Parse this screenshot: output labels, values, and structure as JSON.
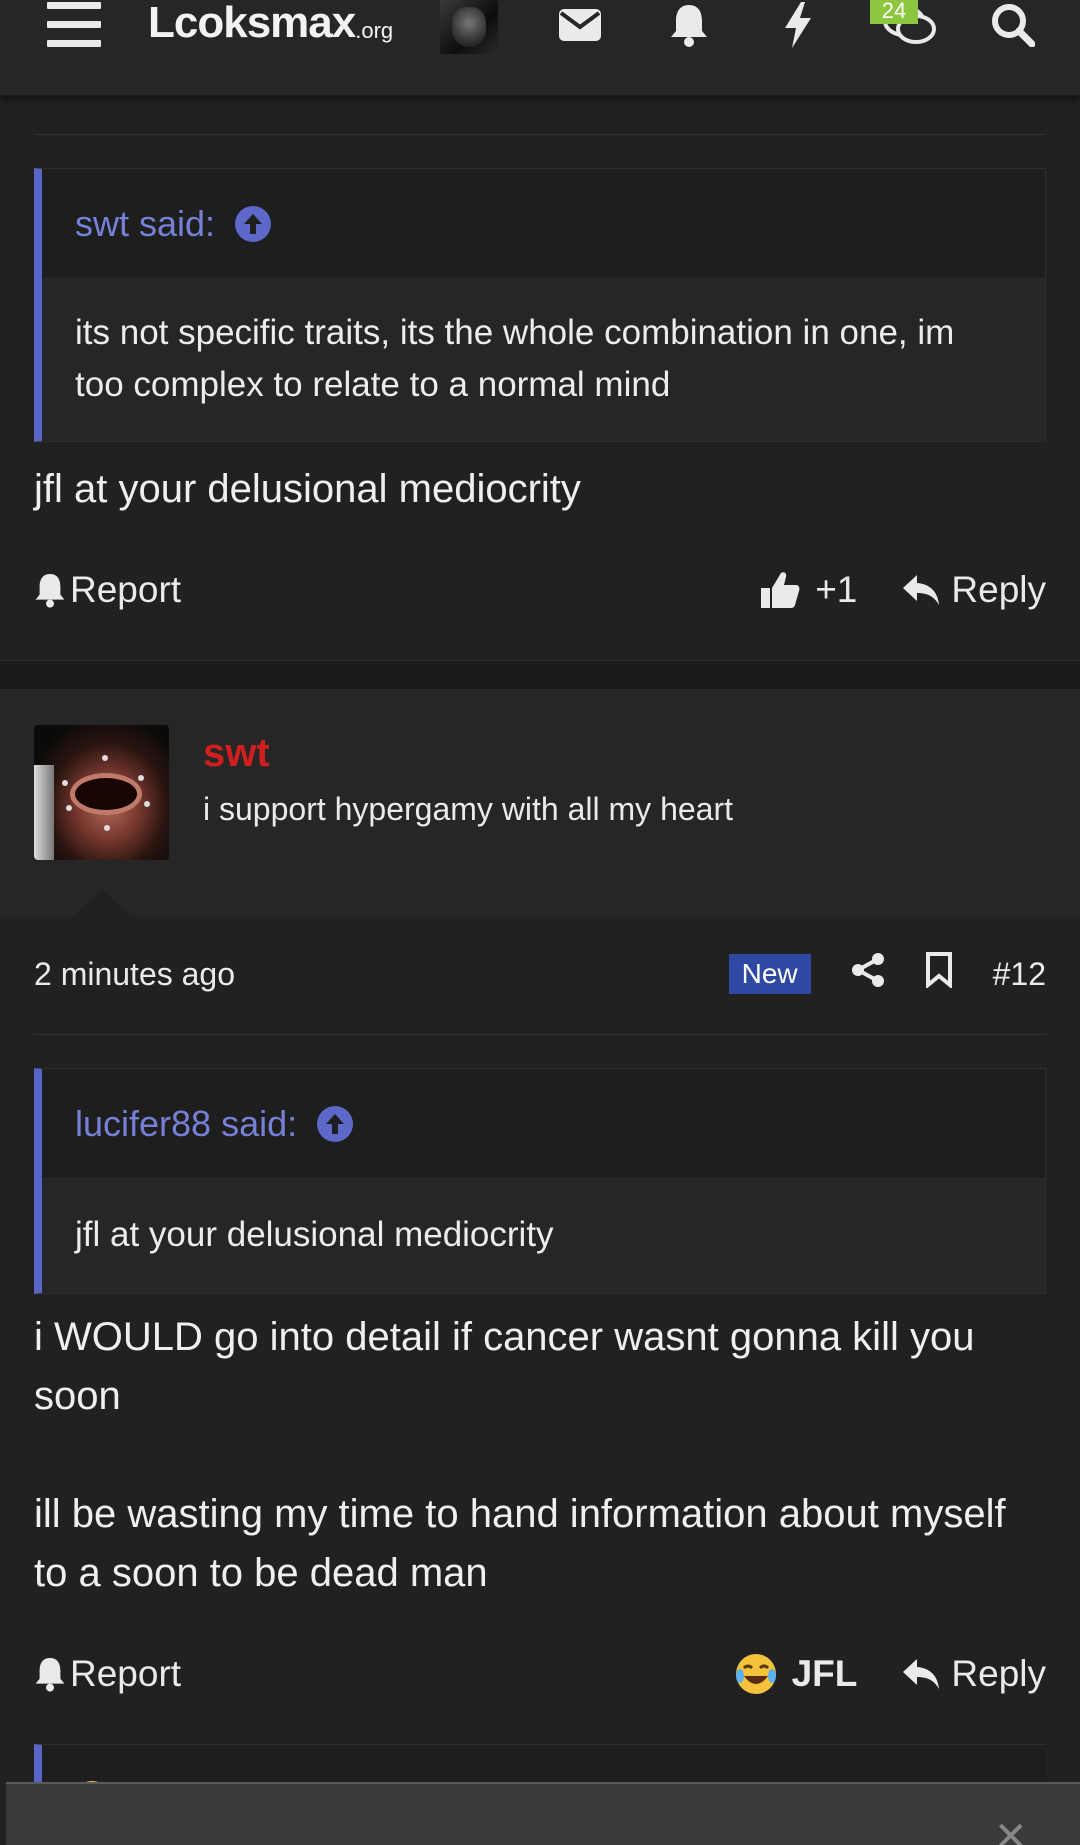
{
  "topbar": {
    "logo_main": "Lcoksmax",
    "logo_suffix": ".org",
    "notification_count": "24"
  },
  "post1": {
    "quote": {
      "author": "swt said:",
      "text": "its not specific traits, its the whole combination in one, im too complex to relate to a normal mind"
    },
    "body": "jfl at your delusional mediocrity",
    "report_label": "Report",
    "reaction_label": "+1",
    "reply_label": "Reply"
  },
  "post2": {
    "username": "swt",
    "user_title": "i support hypergamy with all my heart",
    "timestamp": "2 minutes ago",
    "new_label": "New",
    "post_number": "#12",
    "quote": {
      "author": "lucifer88 said:",
      "text": "jfl at your delusional mediocrity"
    },
    "body_para1": "i WOULD go into detail if cancer wasnt gonna kill you soon",
    "body_para2": "ill be wasting my time to hand information about myself to a soon to be dead man",
    "report_label": "Report",
    "reaction_label": "JFL",
    "reply_label": "Reply"
  },
  "colors": {
    "accent_quote": "#5865c4",
    "username_red": "#d01f1f",
    "badge_green": "#8dc63f",
    "new_badge": "#2f49a3"
  }
}
